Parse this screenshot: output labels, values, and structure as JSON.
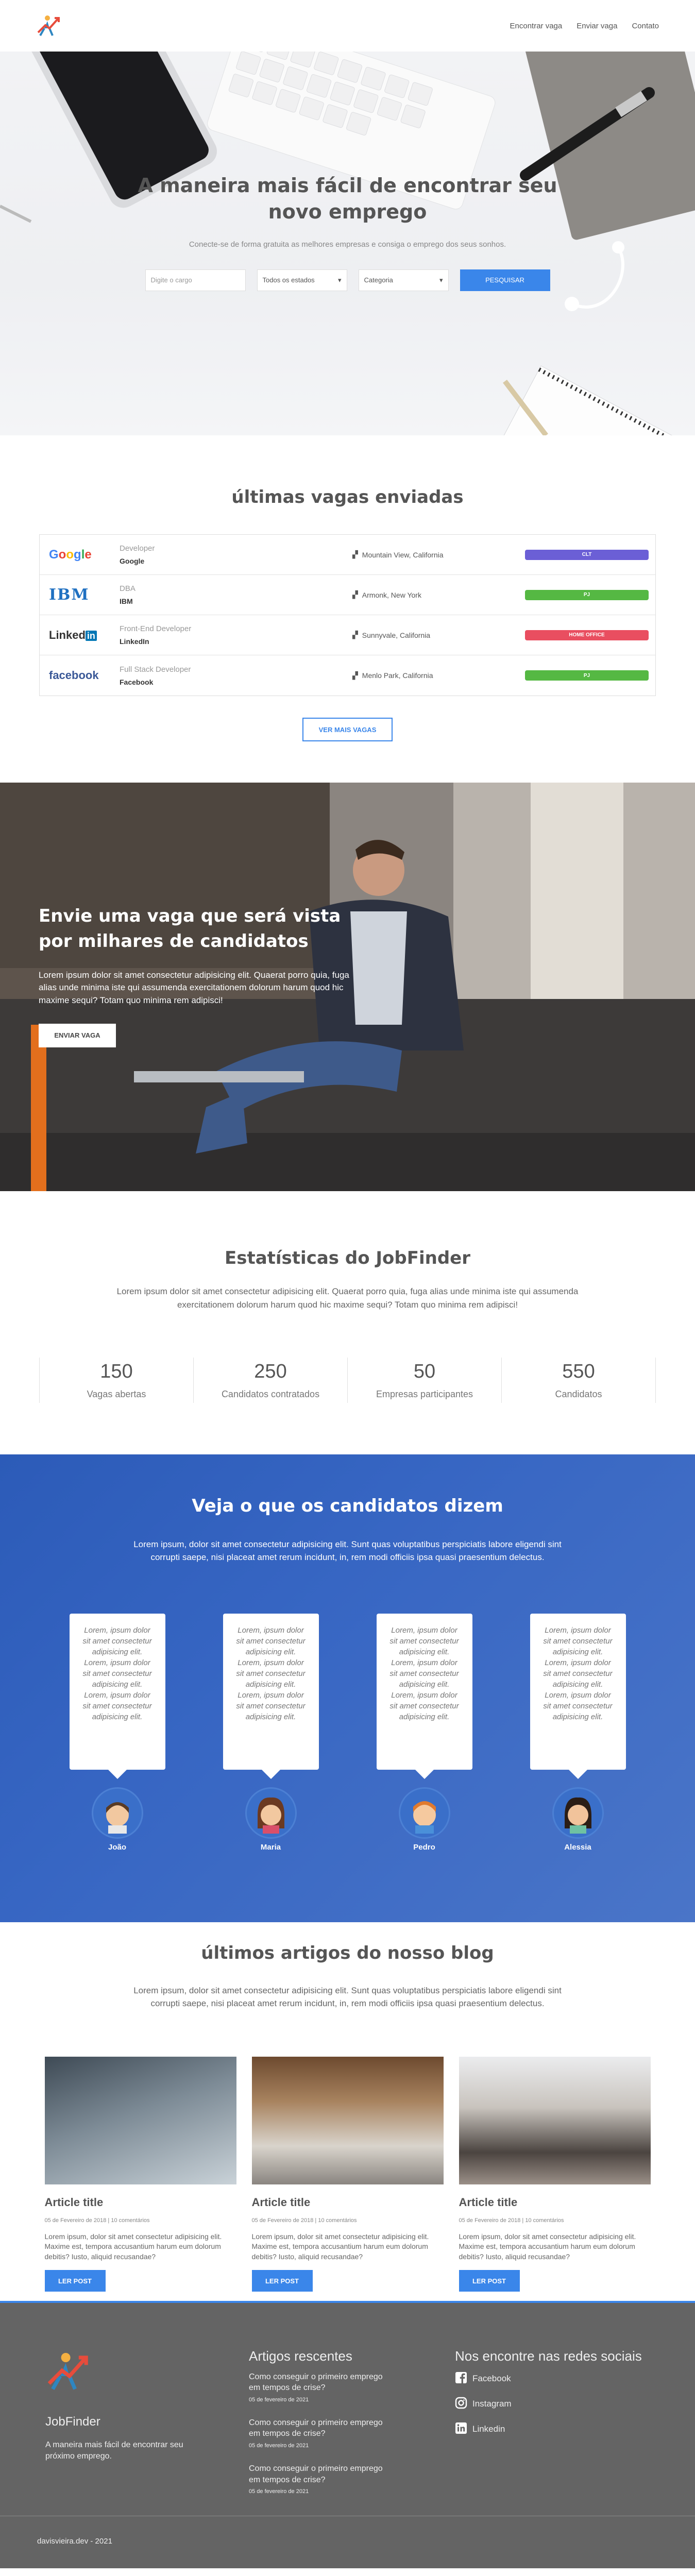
{
  "nav": {
    "links": [
      "Encontrar vaga",
      "Enviar vaga",
      "Contato"
    ]
  },
  "hero": {
    "title": "A maneira mais fácil de encontrar seu novo emprego",
    "subtitle": "Conecte-se de forma gratuita as melhores empresas e consiga o emprego dos seus sonhos.",
    "search_placeholder": "Digite o cargo",
    "state_select": "Todos os estados",
    "category_select": "Categoria",
    "search_button": "PESQUISAR"
  },
  "jobs": {
    "heading": "últimas vagas enviadas",
    "rows": [
      {
        "logo": "Google",
        "role": "Developer",
        "company": "Google",
        "location": "Mountain View, California",
        "badge": "CLT",
        "badge_color": "#6b5fd6"
      },
      {
        "logo": "IBM",
        "role": "DBA",
        "company": "IBM",
        "location": "Armonk, New York",
        "badge": "PJ",
        "badge_color": "#55b843"
      },
      {
        "logo": "LinkedIn",
        "role": "Front-End Developer",
        "company": "LinkedIn",
        "location": "Sunnyvale, California",
        "badge": "HOME OFFICE",
        "badge_color": "#e94e60"
      },
      {
        "logo": "facebook",
        "role": "Full Stack Developer",
        "company": "Facebook",
        "location": "Menlo Park, California",
        "badge": "PJ",
        "badge_color": "#55b843"
      }
    ],
    "more_button": "VER MAIS VAGAS"
  },
  "send": {
    "title": "Envie uma vaga que será vista por milhares de candidatos",
    "text": "Lorem ipsum dolor sit amet consectetur adipisicing elit. Quaerat porro quia, fuga alias unde minima iste qui assumenda exercitationem dolorum harum quod hic maxime sequi? Totam quo minima rem adipisci!",
    "button": "ENVIAR VAGA"
  },
  "stats": {
    "heading": "Estatísticas do JobFinder",
    "lead": "Lorem ipsum dolor sit amet consectetur adipisicing elit. Quaerat porro quia, fuga alias unde minima iste qui assumenda exercitationem dolorum harum quod hic maxime sequi? Totam quo minima rem adipisci!",
    "items": [
      {
        "number": "150",
        "label": "Vagas abertas"
      },
      {
        "number": "250",
        "label": "Candidatos contratados"
      },
      {
        "number": "50",
        "label": "Empresas participantes"
      },
      {
        "number": "550",
        "label": "Candidatos"
      }
    ]
  },
  "testimonials": {
    "heading": "Veja o que os candidatos dizem",
    "lead": "Lorem ipsum, dolor sit amet consectetur adipisicing elit. Sunt quas voluptatibus perspiciatis labore eligendi sint corrupti saepe, nisi placeat amet rerum incidunt, in, rem modi officiis ipsa quasi praesentium delectus.",
    "quote": "Lorem, ipsum dolor sit amet consectetur adipisicing elit. Lorem, ipsum dolor sit amet consectetur adipisicing elit. Lorem, ipsum dolor sit amet consectetur adipisicing elit.",
    "people": [
      "João",
      "Maria",
      "Pedro",
      "Alessia"
    ]
  },
  "blog": {
    "heading": "últimos artigos do nosso blog",
    "lead": "Lorem ipsum, dolor sit amet consectetur adipisicing elit. Sunt quas voluptatibus perspiciatis labore eligendi sint corrupti saepe, nisi placeat amet rerum incidunt, in, rem modi officiis ipsa quasi praesentium delectus.",
    "posts": [
      {
        "title": "Article title",
        "meta": "05 de Fevereiro de 2018 | 10 comentários",
        "excerpt": "Lorem ipsum, dolor sit amet consectetur adipisicing elit. Maxime est, tempora accusantium harum eum dolorum debitis? Iusto, aliquid recusandae?",
        "button": "LER POST"
      },
      {
        "title": "Article title",
        "meta": "05 de Fevereiro de 2018 | 10 comentários",
        "excerpt": "Lorem ipsum, dolor sit amet consectetur adipisicing elit. Maxime est, tempora accusantium harum eum dolorum debitis? Iusto, aliquid recusandae?",
        "button": "LER POST"
      },
      {
        "title": "Article title",
        "meta": "05 de Fevereiro de 2018 | 10 comentários",
        "excerpt": "Lorem ipsum, dolor sit amet consectetur adipisicing elit. Maxime est, tempora accusantium harum eum dolorum debitis? Iusto, aliquid recusandae?",
        "button": "LER POST"
      }
    ]
  },
  "footer": {
    "brand": "JobFinder",
    "desc": "A maneira mais fácil de encontrar seu próximo emprego.",
    "recent_heading": "Artigos rescentes",
    "recent": [
      {
        "title": "Como conseguir o primeiro emprego em tempos de crise?",
        "date": "05 de fevereiro de 2021"
      },
      {
        "title": "Como conseguir o primeiro emprego em tempos de crise?",
        "date": "05 de fevereiro de 2021"
      },
      {
        "title": "Como conseguir o primeiro emprego em tempos de crise?",
        "date": "05 de fevereiro de 2021"
      }
    ],
    "social_heading": "Nos encontre nas redes sociais",
    "socials": [
      "Facebook",
      "Instagram",
      "Linkedin"
    ],
    "copyright": "davisvieira.dev - 2021"
  }
}
